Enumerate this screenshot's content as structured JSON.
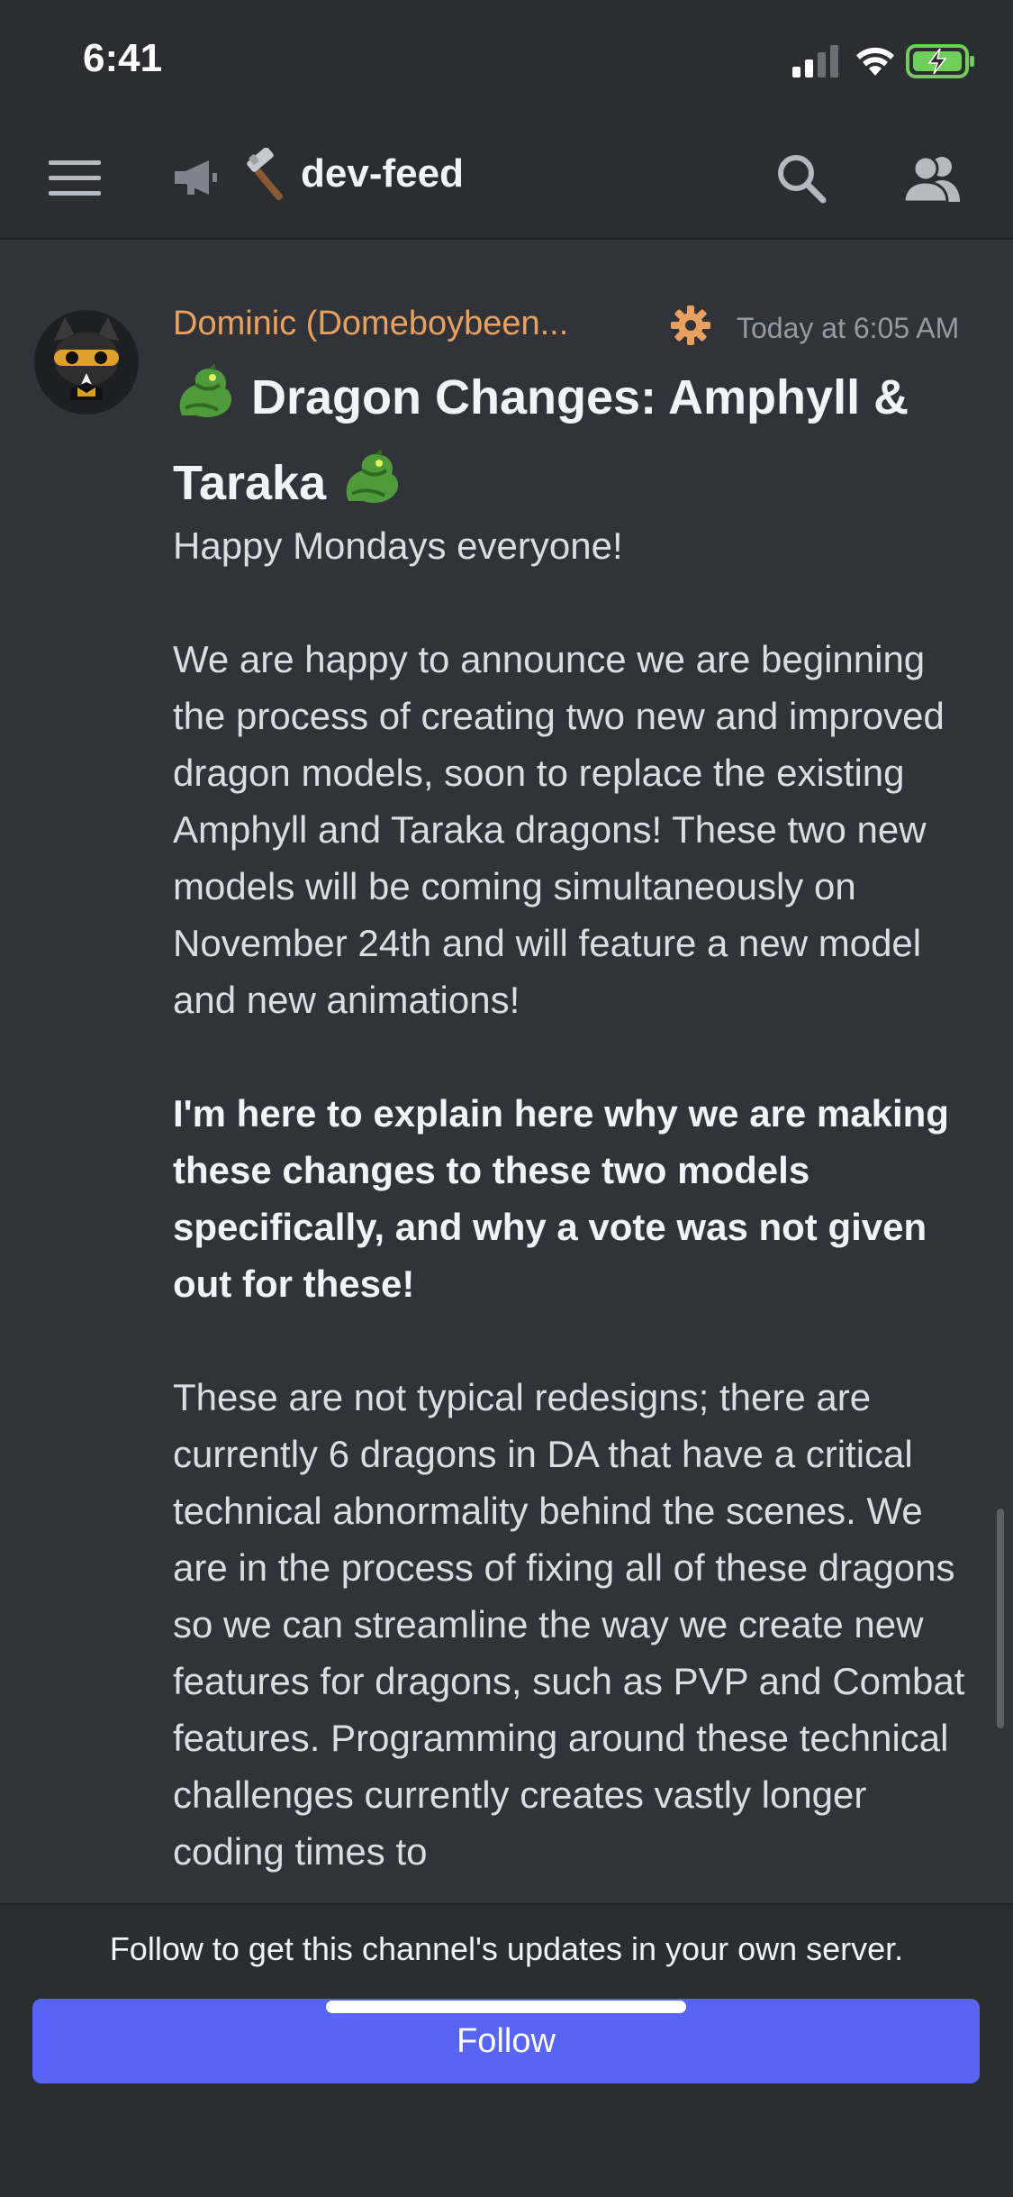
{
  "status_bar": {
    "time": "6:41"
  },
  "header": {
    "channel_name": "dev-feed",
    "icons": [
      "menu-icon",
      "megaphone-icon",
      "hammer-icon",
      "search-icon",
      "members-icon"
    ]
  },
  "message": {
    "author": "Dominic (Domeboybeen...",
    "timestamp": "Today at 6:05 AM",
    "title": {
      "line1": "Dragon Changes: Amphyll &",
      "line2": "Taraka"
    },
    "paragraphs": {
      "p1": "Happy Mondays everyone!",
      "p2": "We are happy to announce we are beginning the process of creating two new and improved dragon models, soon to replace the existing Amphyll and Taraka dragons! These two new models will be coming simultaneously on November 24th and will feature a new model and new animations!",
      "p3": "I'm here to explain here why we are making these changes to these two models specifically, and why a vote was not given out for these!",
      "p4": "These are not typical redesigns; there are currently 6 dragons in DA that have a critical technical abnormality behind the scenes. We are in the process of fixing all of these dragons so we can streamline the way we create new features for dragons, such as PVP and Combat features. Programming around these technical challenges currently creates vastly longer coding times to"
    }
  },
  "follow_bar": {
    "prompt": "Follow to get this channel's updates in your own server.",
    "button_label": "Follow"
  },
  "colors": {
    "background": "#313338",
    "header_bg": "#2b2d31",
    "author_color": "#e9a15f",
    "accent": "#5865f2"
  }
}
